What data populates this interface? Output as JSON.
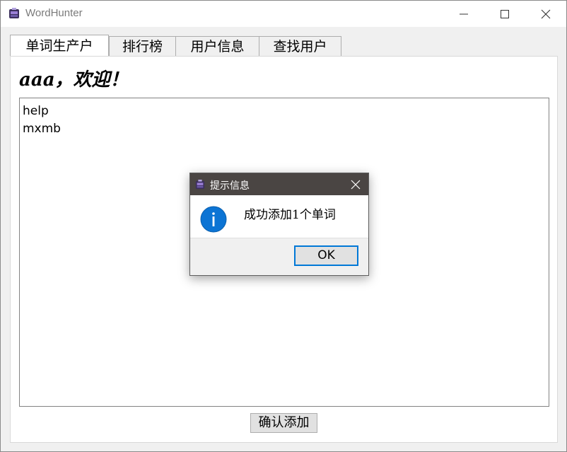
{
  "window": {
    "title": "WordHunter",
    "controls": {
      "minimize": "minimize-icon",
      "maximize": "maximize-icon",
      "close": "close-icon"
    }
  },
  "tabs": [
    {
      "label": "单词生产户",
      "active": true
    },
    {
      "label": "排行榜",
      "active": false
    },
    {
      "label": "用户信息",
      "active": false
    },
    {
      "label": "查找用户",
      "active": false
    }
  ],
  "main": {
    "welcome": "aaa，欢迎！",
    "words": [
      "help",
      "mxmb"
    ],
    "confirm_label": "确认添加"
  },
  "dialog": {
    "title": "提示信息",
    "icon": "info-icon",
    "message": "成功添加1个单词",
    "ok_label": "OK"
  },
  "colors": {
    "accent": "#0078d7",
    "dialog_titlebar": "#4a4543",
    "info_blue": "#0c74d4"
  }
}
